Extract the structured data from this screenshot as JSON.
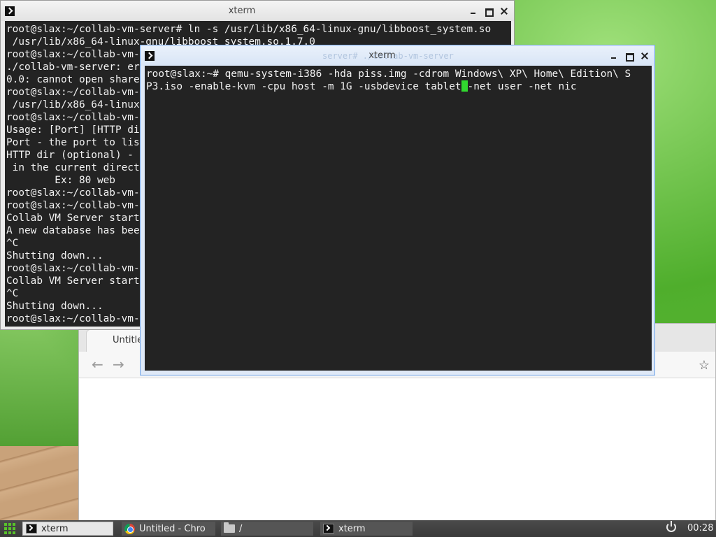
{
  "xterm_back": {
    "title": "xterm",
    "lines": [
      "root@slax:~/collab-vm-server# ln -s /usr/lib/x86_64-linux-gnu/libboost_system.so",
      " /usr/lib/x86_64-linux-gnu/libboost_system.so.1.7.0",
      "root@slax:~/collab-vm-",
      "./collab-vm-server: er",
      "0.0: cannot open share",
      "root@slax:~/collab-vm-",
      " /usr/lib/x86_64-linux",
      "root@slax:~/collab-vm-",
      "Usage: [Port] [HTTP di",
      "Port - the port to lis",
      "HTTP dir (optional) -",
      " in the current direct",
      "        Ex: 80 web",
      "root@slax:~/collab-vm-",
      "root@slax:~/collab-vm-",
      "Collab VM Server start",
      "A new database has bee",
      "^C",
      "Shutting down...",
      "root@slax:~/collab-vm-",
      "Collab VM Server start",
      "^C",
      "Shutting down...",
      "root@slax:~/collab-vm-"
    ]
  },
  "xterm_front": {
    "title": "xterm",
    "ghost_text": "server# ./collab-vm-server",
    "line1": "root@slax:~# qemu-system-i386 -hda piss.img -cdrom Windows\\ XP\\ Home\\ Edition\\ S",
    "line2_before_cursor": "P3.iso -enable-kvm -cpu host -m 1G -usbdevice tablet",
    "line2_after_cursor": "-net user -net nic"
  },
  "chrome": {
    "tab_label": "Untitle",
    "back_glyph": "←",
    "forward_glyph": "→",
    "star_glyph": "☆"
  },
  "taskbar": {
    "items": [
      {
        "label": "xterm",
        "icon": "terminal-icon"
      },
      {
        "label": "Untitled - Chro",
        "icon": "chrome-icon"
      },
      {
        "label": "/",
        "icon": "folder-icon"
      },
      {
        "label": "xterm",
        "icon": "terminal-icon"
      }
    ],
    "clock": "00:28"
  },
  "colors": {
    "terminal_bg": "#232323",
    "cursor": "#31d82f",
    "focus_border": "#6fa4e8",
    "taskbar_bg": "#3a3a3a"
  }
}
